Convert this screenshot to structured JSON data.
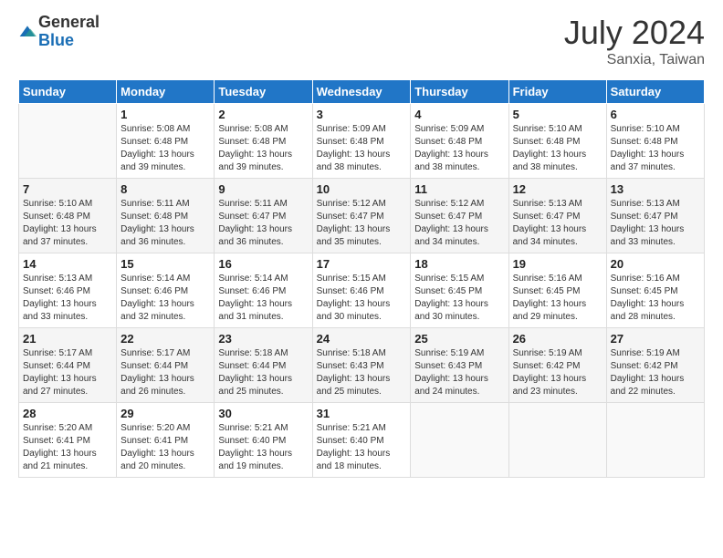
{
  "header": {
    "logo_line1": "General",
    "logo_line2": "Blue",
    "month": "July 2024",
    "location": "Sanxia, Taiwan"
  },
  "weekdays": [
    "Sunday",
    "Monday",
    "Tuesday",
    "Wednesday",
    "Thursday",
    "Friday",
    "Saturday"
  ],
  "weeks": [
    [
      {
        "day": "",
        "sunrise": "",
        "sunset": "",
        "daylight": ""
      },
      {
        "day": "1",
        "sunrise": "5:08 AM",
        "sunset": "6:48 PM",
        "daylight": "13 hours and 39 minutes."
      },
      {
        "day": "2",
        "sunrise": "5:08 AM",
        "sunset": "6:48 PM",
        "daylight": "13 hours and 39 minutes."
      },
      {
        "day": "3",
        "sunrise": "5:09 AM",
        "sunset": "6:48 PM",
        "daylight": "13 hours and 38 minutes."
      },
      {
        "day": "4",
        "sunrise": "5:09 AM",
        "sunset": "6:48 PM",
        "daylight": "13 hours and 38 minutes."
      },
      {
        "day": "5",
        "sunrise": "5:10 AM",
        "sunset": "6:48 PM",
        "daylight": "13 hours and 38 minutes."
      },
      {
        "day": "6",
        "sunrise": "5:10 AM",
        "sunset": "6:48 PM",
        "daylight": "13 hours and 37 minutes."
      }
    ],
    [
      {
        "day": "7",
        "sunrise": "5:10 AM",
        "sunset": "6:48 PM",
        "daylight": "13 hours and 37 minutes."
      },
      {
        "day": "8",
        "sunrise": "5:11 AM",
        "sunset": "6:48 PM",
        "daylight": "13 hours and 36 minutes."
      },
      {
        "day": "9",
        "sunrise": "5:11 AM",
        "sunset": "6:47 PM",
        "daylight": "13 hours and 36 minutes."
      },
      {
        "day": "10",
        "sunrise": "5:12 AM",
        "sunset": "6:47 PM",
        "daylight": "13 hours and 35 minutes."
      },
      {
        "day": "11",
        "sunrise": "5:12 AM",
        "sunset": "6:47 PM",
        "daylight": "13 hours and 34 minutes."
      },
      {
        "day": "12",
        "sunrise": "5:13 AM",
        "sunset": "6:47 PM",
        "daylight": "13 hours and 34 minutes."
      },
      {
        "day": "13",
        "sunrise": "5:13 AM",
        "sunset": "6:47 PM",
        "daylight": "13 hours and 33 minutes."
      }
    ],
    [
      {
        "day": "14",
        "sunrise": "5:13 AM",
        "sunset": "6:46 PM",
        "daylight": "13 hours and 33 minutes."
      },
      {
        "day": "15",
        "sunrise": "5:14 AM",
        "sunset": "6:46 PM",
        "daylight": "13 hours and 32 minutes."
      },
      {
        "day": "16",
        "sunrise": "5:14 AM",
        "sunset": "6:46 PM",
        "daylight": "13 hours and 31 minutes."
      },
      {
        "day": "17",
        "sunrise": "5:15 AM",
        "sunset": "6:46 PM",
        "daylight": "13 hours and 30 minutes."
      },
      {
        "day": "18",
        "sunrise": "5:15 AM",
        "sunset": "6:45 PM",
        "daylight": "13 hours and 30 minutes."
      },
      {
        "day": "19",
        "sunrise": "5:16 AM",
        "sunset": "6:45 PM",
        "daylight": "13 hours and 29 minutes."
      },
      {
        "day": "20",
        "sunrise": "5:16 AM",
        "sunset": "6:45 PM",
        "daylight": "13 hours and 28 minutes."
      }
    ],
    [
      {
        "day": "21",
        "sunrise": "5:17 AM",
        "sunset": "6:44 PM",
        "daylight": "13 hours and 27 minutes."
      },
      {
        "day": "22",
        "sunrise": "5:17 AM",
        "sunset": "6:44 PM",
        "daylight": "13 hours and 26 minutes."
      },
      {
        "day": "23",
        "sunrise": "5:18 AM",
        "sunset": "6:44 PM",
        "daylight": "13 hours and 25 minutes."
      },
      {
        "day": "24",
        "sunrise": "5:18 AM",
        "sunset": "6:43 PM",
        "daylight": "13 hours and 25 minutes."
      },
      {
        "day": "25",
        "sunrise": "5:19 AM",
        "sunset": "6:43 PM",
        "daylight": "13 hours and 24 minutes."
      },
      {
        "day": "26",
        "sunrise": "5:19 AM",
        "sunset": "6:42 PM",
        "daylight": "13 hours and 23 minutes."
      },
      {
        "day": "27",
        "sunrise": "5:19 AM",
        "sunset": "6:42 PM",
        "daylight": "13 hours and 22 minutes."
      }
    ],
    [
      {
        "day": "28",
        "sunrise": "5:20 AM",
        "sunset": "6:41 PM",
        "daylight": "13 hours and 21 minutes."
      },
      {
        "day": "29",
        "sunrise": "5:20 AM",
        "sunset": "6:41 PM",
        "daylight": "13 hours and 20 minutes."
      },
      {
        "day": "30",
        "sunrise": "5:21 AM",
        "sunset": "6:40 PM",
        "daylight": "13 hours and 19 minutes."
      },
      {
        "day": "31",
        "sunrise": "5:21 AM",
        "sunset": "6:40 PM",
        "daylight": "13 hours and 18 minutes."
      },
      {
        "day": "",
        "sunrise": "",
        "sunset": "",
        "daylight": ""
      },
      {
        "day": "",
        "sunrise": "",
        "sunset": "",
        "daylight": ""
      },
      {
        "day": "",
        "sunrise": "",
        "sunset": "",
        "daylight": ""
      }
    ]
  ],
  "labels": {
    "sunrise_prefix": "Sunrise: ",
    "sunset_prefix": "Sunset: ",
    "daylight_prefix": "Daylight: "
  }
}
